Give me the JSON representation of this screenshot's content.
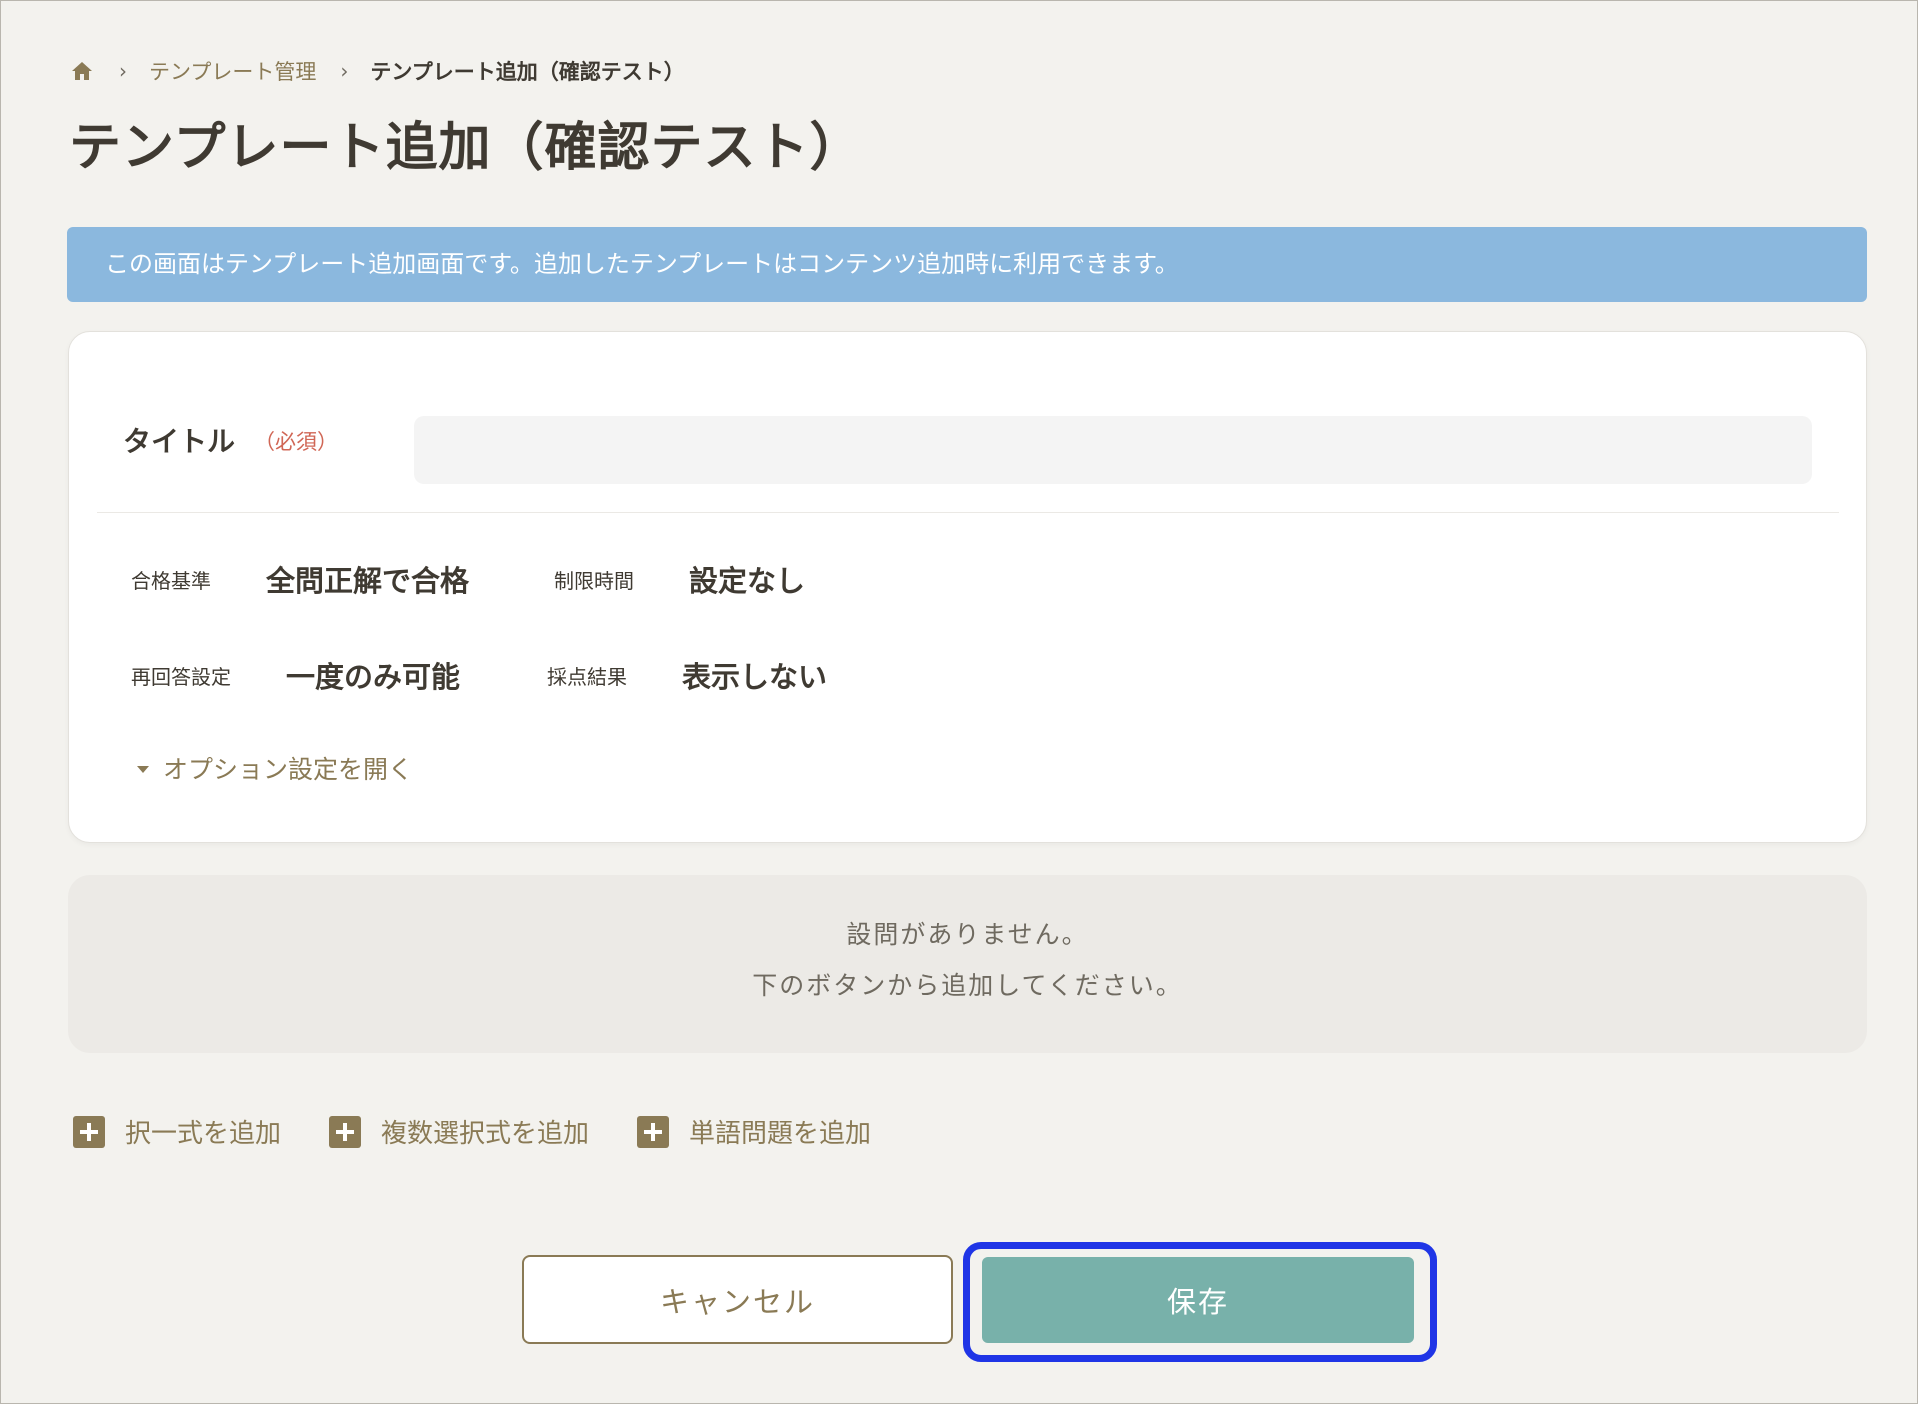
{
  "breadcrumb": {
    "home_icon": "home-icon",
    "separator": "›",
    "items": [
      "テンプレート管理",
      "テンプレート追加（確認テスト）"
    ]
  },
  "page": {
    "title": "テンプレート追加（確認テスト）"
  },
  "info_banner": {
    "text": "この画面はテンプレート追加画面です。追加したテンプレートはコンテンツ追加時に利用できます。"
  },
  "form": {
    "title_label": "タイトル",
    "required_mark": "（必須）",
    "title_value": "",
    "settings": [
      {
        "label": "合格基準",
        "value": "全問正解で合格"
      },
      {
        "label": "制限時間",
        "value": "設定なし"
      },
      {
        "label": "再回答設定",
        "value": "一度のみ可能"
      },
      {
        "label": "採点結果",
        "value": "表示しない"
      }
    ],
    "options_toggle": "オプション設定を開く"
  },
  "empty_state": {
    "line1": "設問がありません。",
    "line2": "下のボタンから追加してください。"
  },
  "add_buttons": [
    {
      "label": "択一式を追加",
      "icon": "plus-square-icon"
    },
    {
      "label": "複数選択式を追加",
      "icon": "plus-square-icon"
    },
    {
      "label": "単語問題を追加",
      "icon": "plus-square-icon"
    }
  ],
  "actions": {
    "cancel_label": "キャンセル",
    "save_label": "保存"
  },
  "colors": {
    "background": "#f3f2ee",
    "accent_brown": "#8a7a55",
    "banner_blue": "#8bb8de",
    "save_teal": "#78b1aa",
    "required_red": "#d06655",
    "focus_ring": "#1f35e6"
  }
}
